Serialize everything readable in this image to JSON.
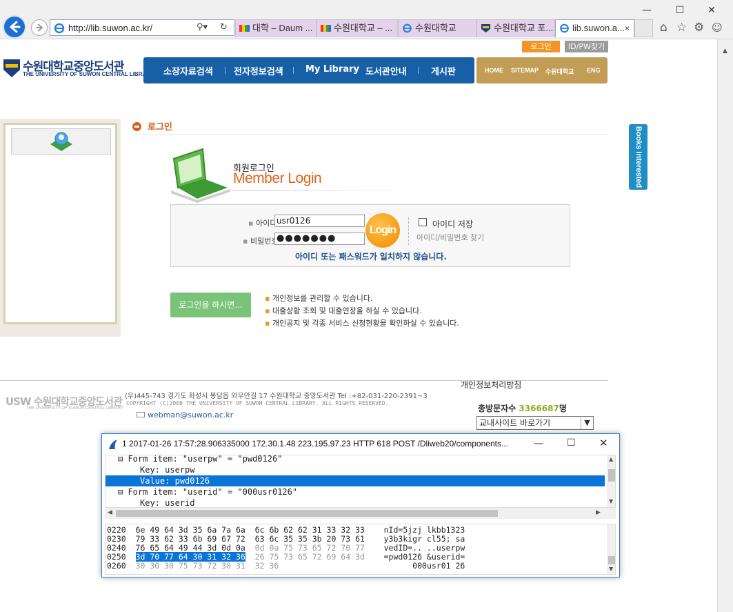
{
  "browser": {
    "url": "http://lib.suwon.ac.kr/",
    "tabs": [
      {
        "label": "대학 – Daum ..."
      },
      {
        "label": "수원대학교 – ..."
      },
      {
        "label": "수원대학교"
      },
      {
        "label": "수원대학교 포..."
      },
      {
        "label": "lib.suwon.a..."
      }
    ],
    "active_tab_close": "×",
    "window_controls": {
      "minimize": "—",
      "maximize": "☐",
      "close": "✕"
    }
  },
  "site": {
    "top_buttons": {
      "login": "로그인",
      "find": "ID/PW찾기"
    },
    "logo": {
      "mark": "USW",
      "title": "수원대학교중앙도서관",
      "subtitle": "THE UNIVERSITY OF SUWON CENTRAL LIBRARY"
    },
    "gnb": [
      "소장자료검색",
      "전자정보검색",
      "My Library",
      "도서관안내",
      "게시판"
    ],
    "util": [
      "HOME",
      "SITEMAP",
      "수원대학교",
      "ENG"
    ],
    "section_title": "로그인",
    "login": {
      "heading_ko": "회원로그인",
      "heading_en": "Member Login",
      "id_label": "아이디",
      "id_value": "usr0126",
      "pw_label": "비밀번호",
      "pw_value": "●●●●●●●",
      "button": "Login",
      "save_id": "아이디 저장",
      "find_link": "아이디/비밀번호 찾기",
      "error": "아이디 또는 패스워드가 일치하지 않습니다."
    },
    "benefits": {
      "button": "로그인을 하시면...",
      "items": [
        "개인정보를 관리할 수 있습니다.",
        "대출상황 조회 및 대출연장을 하실 수 있습니다.",
        "개인공지 및 각종 서비스 신청현황을 확인하실 수 있습니다."
      ]
    },
    "books_tab": "Books Interested",
    "footer": {
      "privacy_link": "개인정보처리방침",
      "logo": "USW 수원대학교중앙도서관",
      "logo_sub": "THE UNIVERSITY OF SUWON CENTRAL LIBRARY",
      "address": "(우)445-743 경기도 화성시 봉담읍 와우안길 17 수원대학교 중앙도서관 Tel :+82-031-220-2391~3",
      "copyright": "COPYRIGHT (C)2008 THE UNIVERSITY OF SUWON CENTRAL LIBRARY. ALL RIGHTS RESERVED.",
      "email": "webman@suwon.ac.kr",
      "visitor_label": "총방문자수",
      "visitor_count": "3366687",
      "visitor_unit": "명",
      "quick_select": "교내사이트 바로가기"
    }
  },
  "wireshark": {
    "title": "1 2017-01-26 17:57:28.906335000 172.30.1.48 223.195.97.23 HTTP 618 POST /Dliweb20/components...",
    "tree": [
      {
        "text": "⊟ Form item: \"userpw\" = \"pwd0126\"",
        "indent": 1,
        "selected": false
      },
      {
        "text": "Key: userpw",
        "indent": 3,
        "selected": false
      },
      {
        "text": "Value: pwd0126",
        "indent": 3,
        "selected": true
      },
      {
        "text": "⊟ Form item: \"userid\" = \"000usr0126\"",
        "indent": 1,
        "selected": false
      },
      {
        "text": "Key: userid",
        "indent": 3,
        "selected": false
      }
    ],
    "hex": [
      {
        "offset": "0220",
        "bytes_a": "6e 49 64 3d 35 6a 7a 6a",
        "bytes_b": "6c 6b 62 62 31 33 32 33",
        "ascii": "nId=5jzj lkbb1323"
      },
      {
        "offset": "0230",
        "bytes_a": "79 33 62 33 6b 69 67 72",
        "bytes_b": "63 6c 35 35 3b 20 73 61",
        "ascii": "y3b3kigr cl55; sa"
      },
      {
        "offset": "0240",
        "bytes_a": "76 65 64 49 44 3d 0d 0a",
        "bytes_b": "0d 0a 75 73 65 72 70 77",
        "ascii": "vedID=.. ..userpw"
      },
      {
        "offset": "0250",
        "bytes_a": "3d 70 77 64 30 31 32 36",
        "bytes_b": "26 75 73 65 72 69 64 3d",
        "ascii": "=pwd0126 &userid="
      },
      {
        "offset": "0260",
        "bytes_a": "30 30 30 75 73 72 30 31",
        "bytes_b": "32 36",
        "ascii": "000usr01 26"
      }
    ]
  }
}
